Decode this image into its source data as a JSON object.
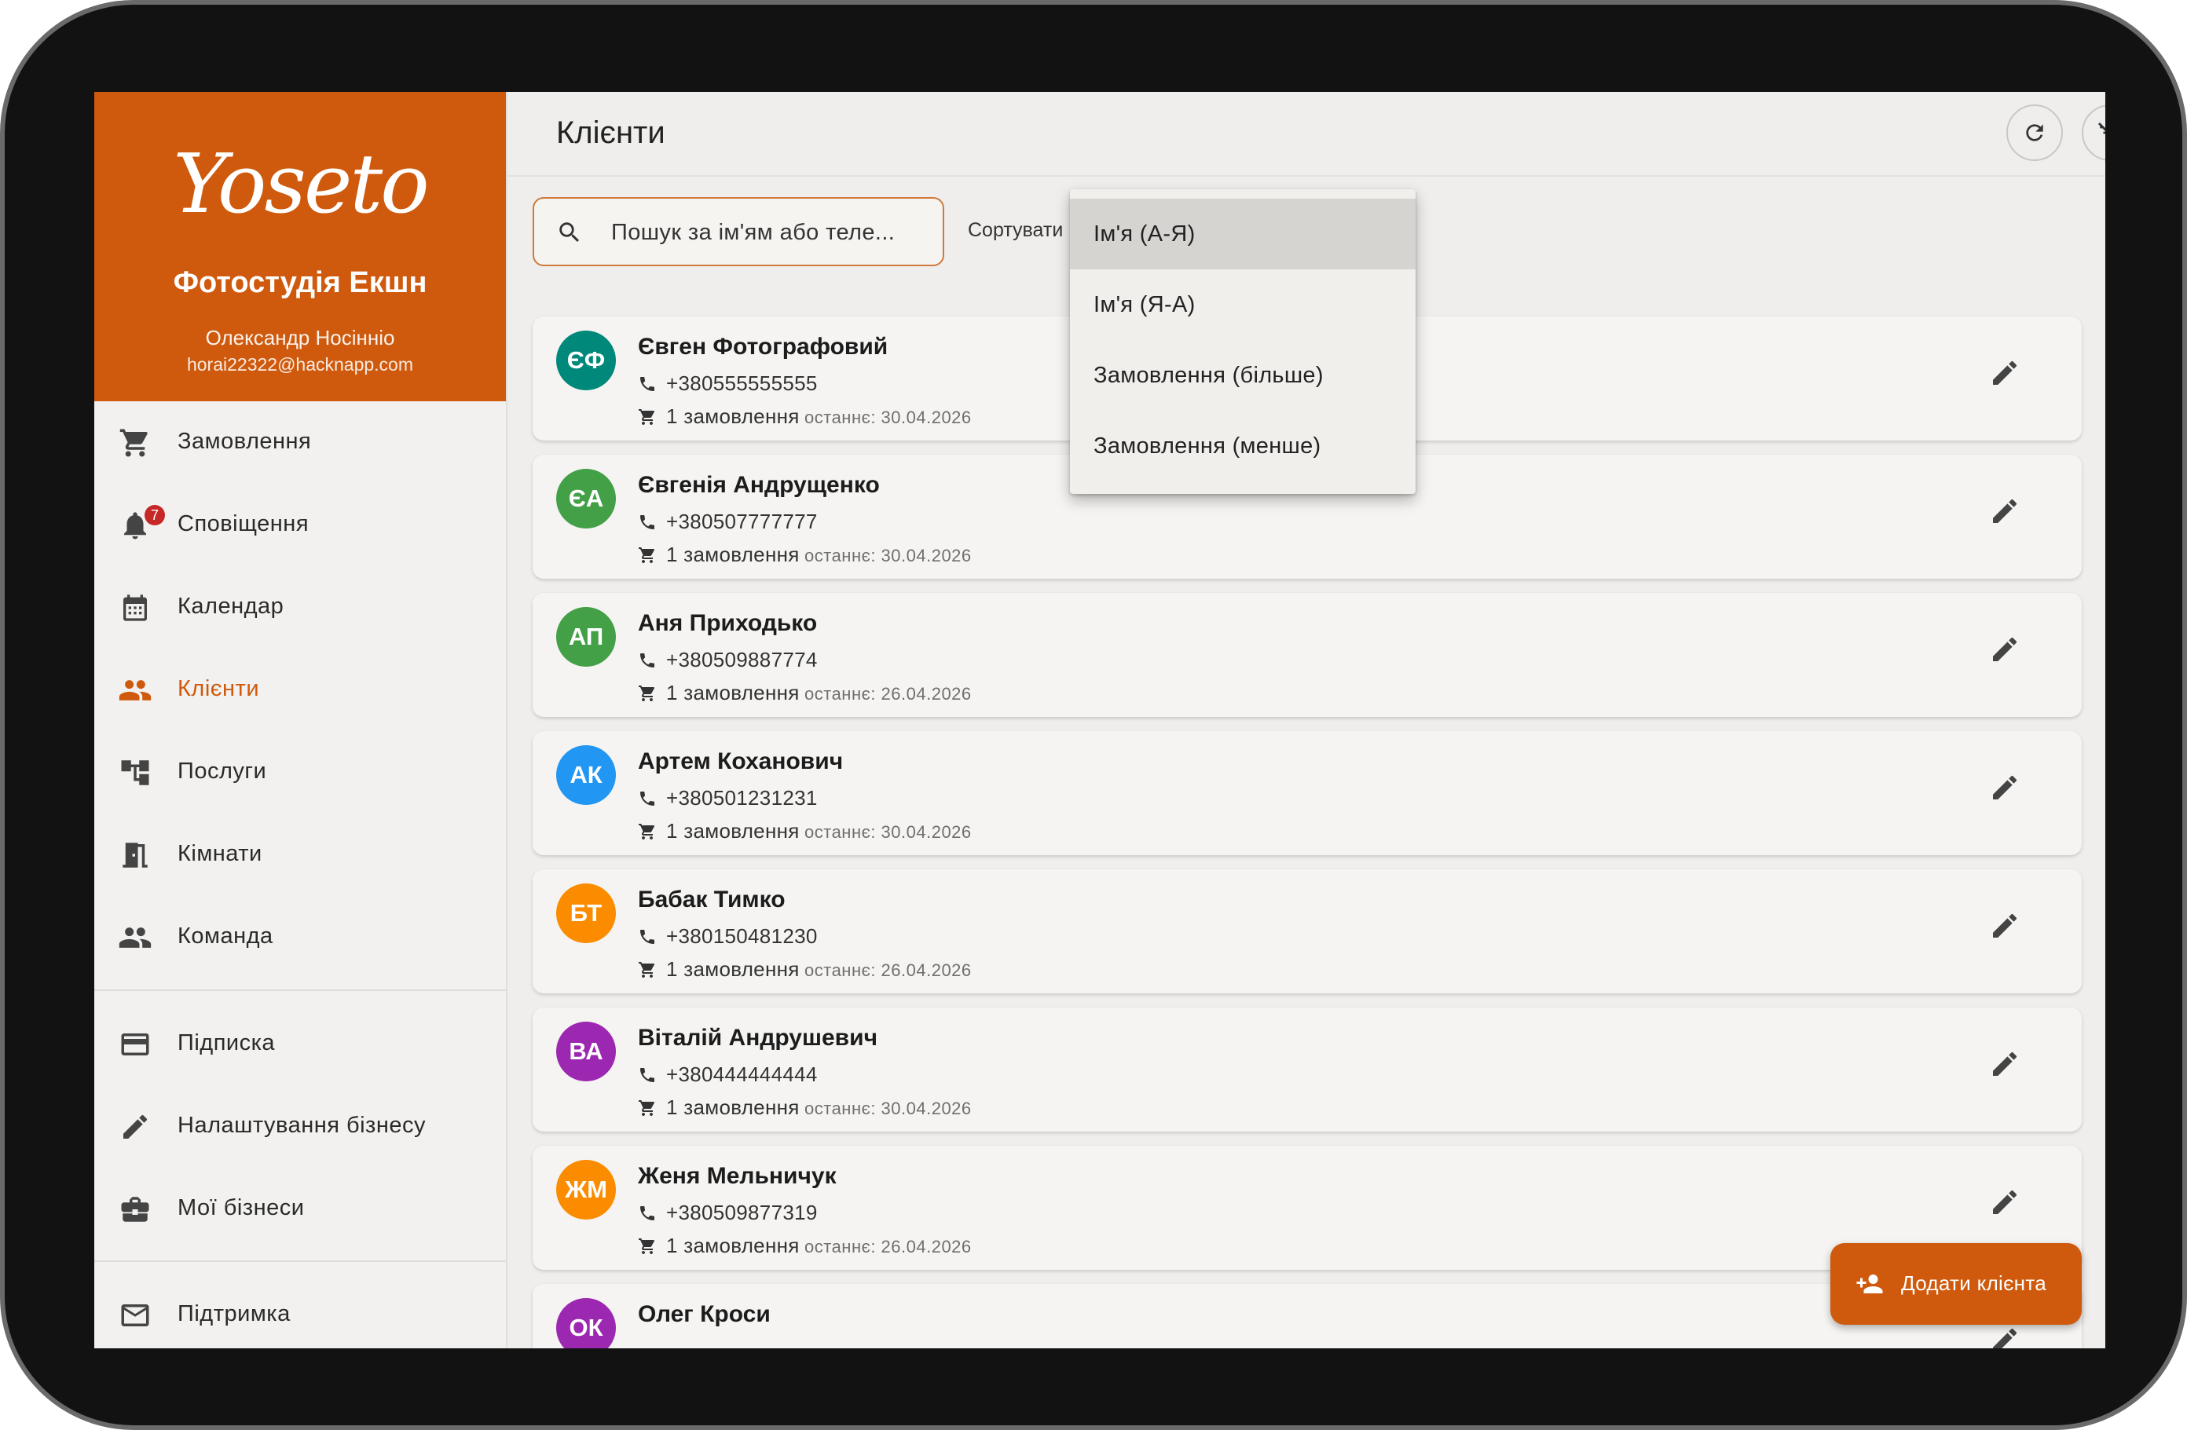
{
  "brand": {
    "logo": "Yoseto",
    "studio": "Фотостудія Екшн",
    "owner": "Олександр Носінніо",
    "email": "horai22322@hacknapp.com",
    "accent": "#cf5a0d"
  },
  "nav": {
    "orders": "Замовлення",
    "notifications": "Сповіщення",
    "notifications_badge": "7",
    "calendar": "Календар",
    "clients": "Клієнти",
    "services": "Послуги",
    "rooms": "Кімнати",
    "team": "Команда",
    "subscription": "Підписка",
    "business_settings": "Налаштування бізнесу",
    "my_businesses": "Мої бізнеси",
    "support": "Підтримка"
  },
  "header": {
    "title": "Клієнти",
    "refresh_icon": "refresh-icon",
    "clear_filter_icon": "filter-off-icon"
  },
  "search": {
    "placeholder": "Пошук за ім'ям або теле..."
  },
  "sort": {
    "label": "Сортувати",
    "options": [
      "Ім'я (А-Я)",
      "Ім'я (Я-А)",
      "Замовлення (більше)",
      "Замовлення (менше)"
    ],
    "selected": "Ім'я (А-Я)"
  },
  "clients": [
    {
      "initials": "ЄФ",
      "name": "Євген Фотографовий",
      "phone": "+380555555555",
      "orders": "1 замовлення",
      "last": "останнє: 30.04.2026",
      "color": "#00897b"
    },
    {
      "initials": "ЄА",
      "name": "Євгенія Андрущенко",
      "phone": "+380507777777",
      "orders": "1 замовлення",
      "last": "останнє: 30.04.2026",
      "color": "#43a047"
    },
    {
      "initials": "АП",
      "name": "Аня Приходько",
      "phone": "+380509887774",
      "orders": "1 замовлення",
      "last": "останнє: 26.04.2026",
      "color": "#43a047"
    },
    {
      "initials": "АК",
      "name": "Артем Коханович",
      "phone": "+380501231231",
      "orders": "1 замовлення",
      "last": "останнє: 30.04.2026",
      "color": "#2196f3"
    },
    {
      "initials": "БТ",
      "name": "Бабак Тимко",
      "phone": "+380150481230",
      "orders": "1 замовлення",
      "last": "останнє: 26.04.2026",
      "color": "#fb8c00"
    },
    {
      "initials": "ВА",
      "name": "Віталій Андрушевич",
      "phone": "+380444444444",
      "orders": "1 замовлення",
      "last": "останнє: 30.04.2026",
      "color": "#9c27b0"
    },
    {
      "initials": "ЖМ",
      "name": "Женя Мельничук",
      "phone": "+380509877319",
      "orders": "1 замовлення",
      "last": "останнє: 26.04.2026",
      "color": "#fb8c00"
    },
    {
      "initials": "ОК",
      "name": "Олег Кроси",
      "phone": "",
      "orders": "",
      "last": "",
      "color": "#9c27b0"
    }
  ],
  "fab": {
    "label": "Додати клієнта"
  }
}
